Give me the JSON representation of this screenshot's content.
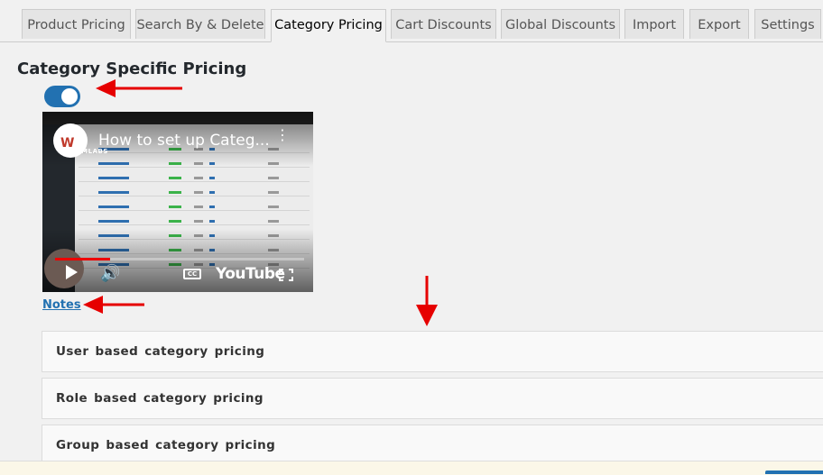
{
  "tabs": [
    {
      "label": "Product Pricing",
      "active": false
    },
    {
      "label": "Search By & Delete",
      "active": false
    },
    {
      "label": "Category Pricing",
      "active": true
    },
    {
      "label": "Cart Discounts",
      "active": false
    },
    {
      "label": "Global Discounts",
      "active": false
    },
    {
      "label": "Import",
      "active": false
    },
    {
      "label": "Export",
      "active": false
    },
    {
      "label": "Settings",
      "active": false
    }
  ],
  "page": {
    "title": "Category Specific Pricing",
    "toggle_on": true,
    "notes_label": "Notes"
  },
  "video": {
    "title": "How to set up Categ...",
    "channel_logo_text": "WISDMLABS",
    "youtube_label": "YouTube",
    "cc_label": "CC",
    "progress": 0.22
  },
  "sections": [
    {
      "label": "User based category pricing"
    },
    {
      "label": "Role based category pricing"
    },
    {
      "label": "Group based category pricing"
    }
  ],
  "colors": {
    "accent": "#2271b1",
    "annotation_arrow": "#e60000",
    "youtube_red": "#ff0000",
    "page_bg": "#f1f1f1"
  },
  "icons": [
    "play-icon",
    "volume-icon",
    "closed-captions-icon",
    "fullscreen-icon",
    "more-options-icon",
    "annotation-arrow-icon"
  ]
}
